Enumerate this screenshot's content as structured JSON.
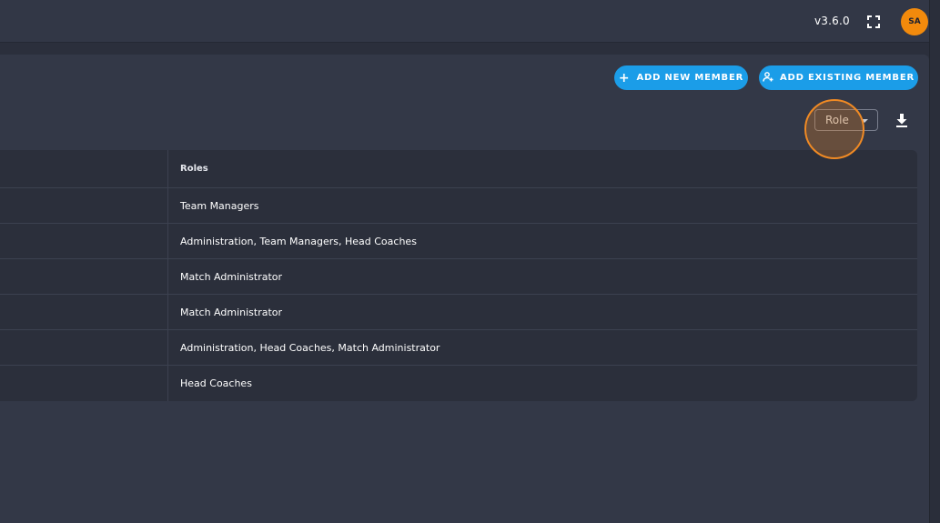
{
  "header": {
    "version": "v3.6.0",
    "fullscreen_icon": "fullscreen-icon",
    "avatar_initials": "SA",
    "avatar_color": "#f28a0c"
  },
  "toolbar": {
    "add_new_label": "ADD NEW MEMBER",
    "add_existing_label": "ADD EXISTING MEMBER",
    "button_color": "#1b9de8",
    "role_filter": "Role",
    "download_icon": "download-icon"
  },
  "table": {
    "roles_header": "Roles",
    "rows": [
      {
        "roles": "Team Managers"
      },
      {
        "roles": "Administration, Team Managers, Head Coaches"
      },
      {
        "roles": "Match Administrator"
      },
      {
        "roles": "Match Administrator"
      },
      {
        "roles": "Administration, Head Coaches, Match Administrator"
      },
      {
        "roles": "Head Coaches"
      }
    ]
  }
}
